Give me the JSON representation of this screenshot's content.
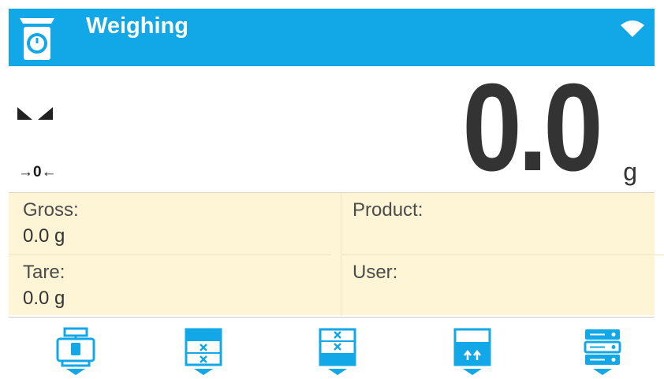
{
  "header": {
    "title": "Weighing",
    "mode_icon": "scale-icon",
    "status_icon": "wifi-icon"
  },
  "display": {
    "value": "0.0",
    "unit": "g",
    "stability_icon": "stable-indicator-icon",
    "zero_indicator": "→0←"
  },
  "info": {
    "gross": {
      "label": "Gross:",
      "value": "0.0 g"
    },
    "tare": {
      "label": "Tare:",
      "value": "0.0 g"
    },
    "product": {
      "label": "Product:",
      "value": ""
    },
    "user": {
      "label": "User:",
      "value": ""
    }
  },
  "buttons": [
    {
      "icon": "tare-weight-icon"
    },
    {
      "icon": "product-database-icon"
    },
    {
      "icon": "user-database-icon"
    },
    {
      "icon": "export-icon"
    },
    {
      "icon": "databases-icon"
    }
  ],
  "colors": {
    "accent": "#12a7e6",
    "info_background": "#fdf5d6",
    "value_text": "#333333"
  }
}
